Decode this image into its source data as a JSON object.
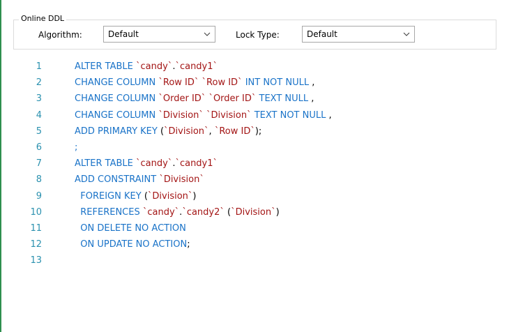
{
  "online_ddl": {
    "group_title": "Online DDL",
    "algorithm_label": "Algorithm:",
    "algorithm_value": "Default",
    "lock_type_label": "Lock Type:",
    "lock_type_value": "Default"
  },
  "colors": {
    "keyword": "#1a73c8",
    "identifier": "#a31515",
    "line_number": "#2b91af"
  },
  "editor": {
    "line_numbers": [
      "1",
      "2",
      "3",
      "4",
      "5",
      "6",
      "7",
      "8",
      "9",
      "10",
      "11",
      "12",
      "13"
    ],
    "lines": [
      [
        {
          "t": "kw",
          "v": "ALTER TABLE "
        },
        {
          "t": "str",
          "v": "`candy`"
        },
        {
          "t": "pun",
          "v": "."
        },
        {
          "t": "str",
          "v": "`candy1`"
        }
      ],
      [
        {
          "t": "kw",
          "v": "CHANGE COLUMN "
        },
        {
          "t": "str",
          "v": "`Row ID`"
        },
        {
          "t": "kw",
          "v": " "
        },
        {
          "t": "str",
          "v": "`Row ID`"
        },
        {
          "t": "kw",
          "v": " INT NOT NULL "
        },
        {
          "t": "pun",
          "v": ","
        }
      ],
      [
        {
          "t": "kw",
          "v": "CHANGE COLUMN "
        },
        {
          "t": "str",
          "v": "`Order ID`"
        },
        {
          "t": "kw",
          "v": " "
        },
        {
          "t": "str",
          "v": "`Order ID`"
        },
        {
          "t": "kw",
          "v": " TEXT NULL "
        },
        {
          "t": "pun",
          "v": ","
        }
      ],
      [
        {
          "t": "kw",
          "v": "CHANGE COLUMN "
        },
        {
          "t": "str",
          "v": "`Division`"
        },
        {
          "t": "kw",
          "v": " "
        },
        {
          "t": "str",
          "v": "`Division`"
        },
        {
          "t": "kw",
          "v": " TEXT NOT NULL "
        },
        {
          "t": "pun",
          "v": ","
        }
      ],
      [
        {
          "t": "kw",
          "v": "ADD PRIMARY KEY "
        },
        {
          "t": "pun",
          "v": "("
        },
        {
          "t": "str",
          "v": "`Division`"
        },
        {
          "t": "pun",
          "v": ", "
        },
        {
          "t": "str",
          "v": "`Row ID`"
        },
        {
          "t": "pun",
          "v": ");"
        }
      ],
      [
        {
          "t": "kw",
          "v": ";"
        }
      ],
      [
        {
          "t": "kw",
          "v": "ALTER TABLE "
        },
        {
          "t": "str",
          "v": "`candy`"
        },
        {
          "t": "pun",
          "v": "."
        },
        {
          "t": "str",
          "v": "`candy1`"
        }
      ],
      [
        {
          "t": "kw",
          "v": "ADD CONSTRAINT "
        },
        {
          "t": "str",
          "v": "`Division`"
        }
      ],
      [
        {
          "t": "kw",
          "v": "  FOREIGN KEY "
        },
        {
          "t": "pun",
          "v": "("
        },
        {
          "t": "str",
          "v": "`Division`"
        },
        {
          "t": "pun",
          "v": ")"
        }
      ],
      [
        {
          "t": "kw",
          "v": "  REFERENCES "
        },
        {
          "t": "str",
          "v": "`candy`"
        },
        {
          "t": "pun",
          "v": "."
        },
        {
          "t": "str",
          "v": "`candy2`"
        },
        {
          "t": "kw",
          "v": " "
        },
        {
          "t": "pun",
          "v": "("
        },
        {
          "t": "str",
          "v": "`Division`"
        },
        {
          "t": "pun",
          "v": ")"
        }
      ],
      [
        {
          "t": "kw",
          "v": "  ON DELETE NO ACTION"
        }
      ],
      [
        {
          "t": "kw",
          "v": "  ON UPDATE NO ACTION"
        },
        {
          "t": "pun",
          "v": ";"
        }
      ],
      []
    ]
  }
}
